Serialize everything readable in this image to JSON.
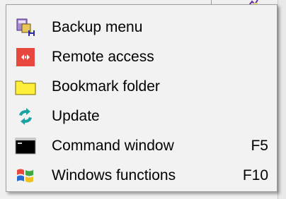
{
  "menu": {
    "items": [
      {
        "label": "Backup menu",
        "icon": "backup-icon",
        "shortcut": ""
      },
      {
        "label": "Remote access",
        "icon": "remote-access-icon",
        "shortcut": ""
      },
      {
        "label": "Bookmark folder",
        "icon": "folder-icon",
        "shortcut": ""
      },
      {
        "label": "Update",
        "icon": "update-icon",
        "shortcut": ""
      },
      {
        "label": "Command window",
        "icon": "command-window-icon",
        "shortcut": "F5"
      },
      {
        "label": "Windows functions",
        "icon": "windows-logo-icon",
        "shortcut": "F10"
      }
    ]
  },
  "colors": {
    "menu_background": "#f2f2f2",
    "menu_border": "#a0a0a0",
    "remote_access_red": "#e8473d",
    "folder_yellow": "#ffef3a",
    "update_teal": "#1aa3a0"
  }
}
